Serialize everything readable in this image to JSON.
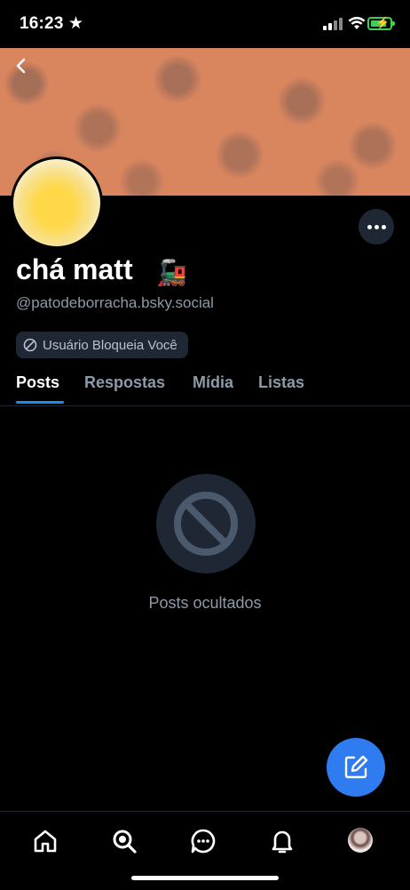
{
  "status_bar": {
    "time": "16:23"
  },
  "profile": {
    "display_name": "chá matt",
    "display_name_emoji": "🚂",
    "handle": "@patodeborracha.bsky.social",
    "block_badge": "Usuário Bloqueia Você"
  },
  "tabs": [
    "Posts",
    "Respostas",
    "Mídia",
    "Listas"
  ],
  "active_tab": "Posts",
  "empty_state": {
    "text": "Posts ocultados"
  },
  "colors": {
    "accent": "#1d8cf0",
    "fab": "#2f7bf0",
    "banner": "#d9865f",
    "muted": "#8d9aa8"
  },
  "icons": {
    "status": [
      "star-icon",
      "signal-icon",
      "wifi-icon",
      "battery-icon"
    ],
    "nav": [
      "home-icon",
      "search-icon",
      "chat-icon",
      "bell-icon",
      "profile-avatar"
    ],
    "other": [
      "back-chevron-icon",
      "more-icon",
      "blocked-icon",
      "compose-icon"
    ]
  }
}
